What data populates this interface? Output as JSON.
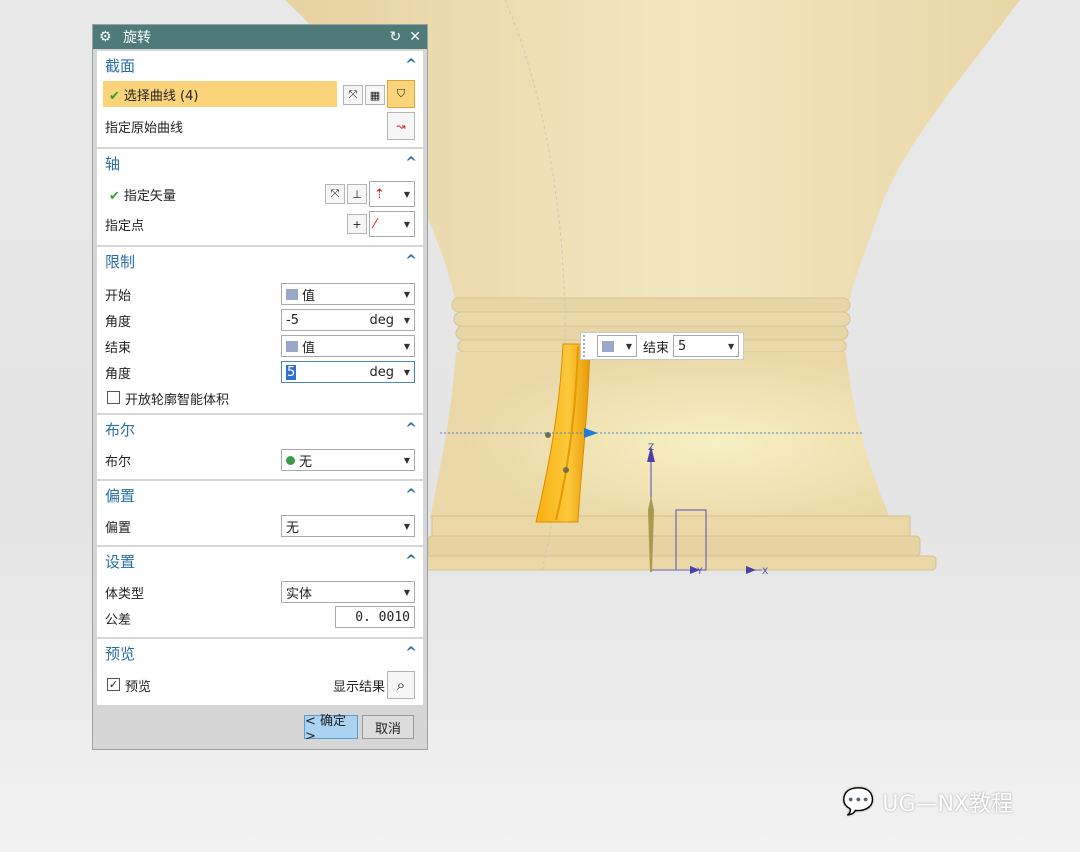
{
  "dialog": {
    "title": "旋转",
    "section_curve": {
      "title": "截面",
      "select_curve": "选择曲线 (4)",
      "specify_origin_curve": "指定原始曲线"
    },
    "section_axis": {
      "title": "轴",
      "specify_vector": "指定矢量",
      "specify_point": "指定点"
    },
    "section_limits": {
      "title": "限制",
      "start_label": "开始",
      "start_value": "值",
      "angle1_label": "角度",
      "angle1_value": "-5",
      "angle1_unit": "deg",
      "end_label": "结束",
      "end_value": "值",
      "angle2_label": "角度",
      "angle2_value": "5",
      "angle2_unit": "deg",
      "open_profile": "开放轮廓智能体积",
      "open_profile_checked": false
    },
    "section_boolean": {
      "title": "布尔",
      "label": "布尔",
      "value": "无"
    },
    "section_offset": {
      "title": "偏置",
      "label": "偏置",
      "value": "无"
    },
    "section_settings": {
      "title": "设置",
      "body_type_label": "体类型",
      "body_type_value": "实体",
      "tolerance_label": "公差",
      "tolerance_value": "0. 0010"
    },
    "section_preview": {
      "title": "预览",
      "preview_label": "预览",
      "preview_checked": true,
      "show_result": "显示结果"
    },
    "ok_button": "< 确定 >",
    "cancel_button": "取消"
  },
  "floating_input": {
    "end_label": "结束",
    "end_value": "5"
  },
  "viewport": {
    "axis_z": "Z",
    "axis_y": "Y",
    "axis_x": "X"
  },
  "watermark": "UG—NX教程",
  "colors": {
    "title_bar": "#4e7a7a",
    "section_title": "#2a6fa8",
    "highlight": "#fbd37a",
    "model": "#f1dfb0",
    "preview_body": "#f7b418",
    "ok_button": "#a9d3f0"
  }
}
